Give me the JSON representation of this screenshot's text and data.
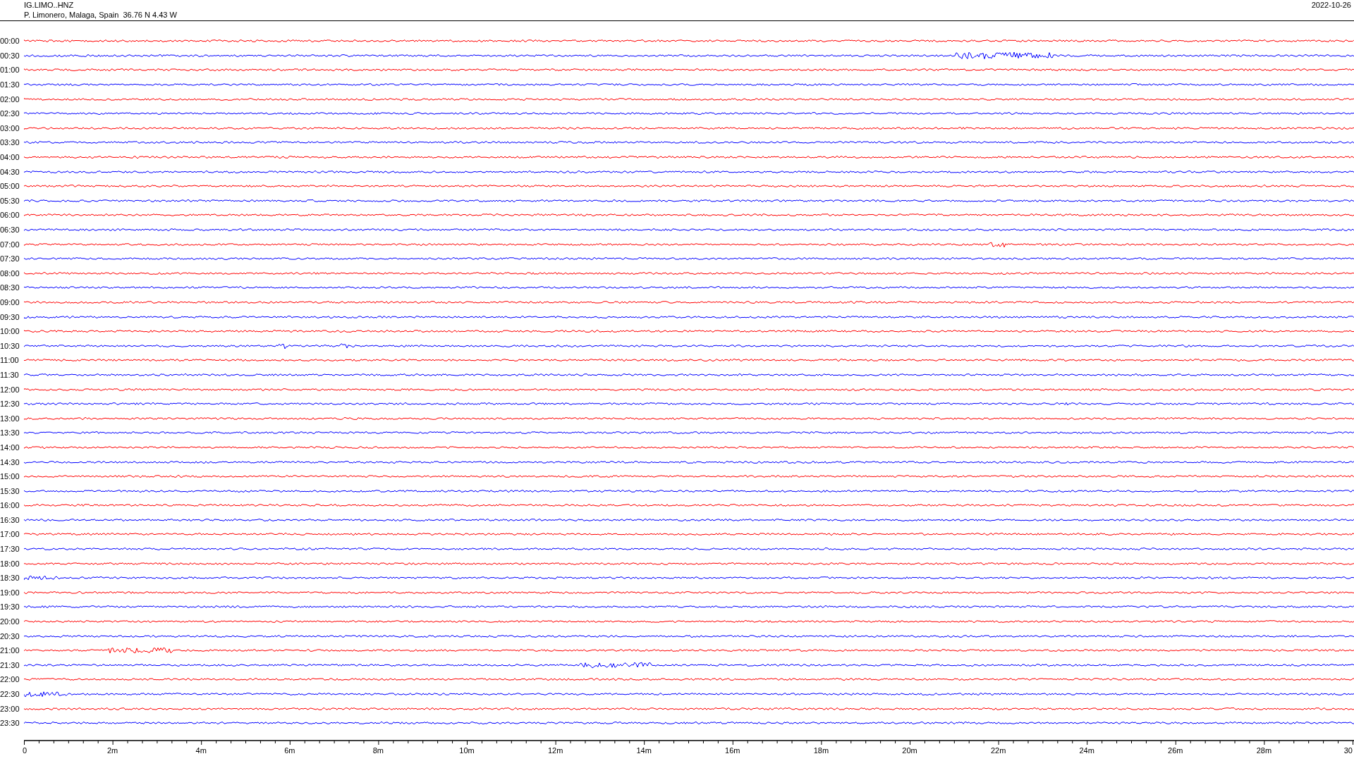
{
  "header": {
    "station": "IG.LIMO..HNZ",
    "location": "P. Limonero, Malaga, Spain  36.76 N 4.43 W",
    "date": "2022-10-26"
  },
  "rows": [
    {
      "label": "00:00",
      "color": "#ff0000"
    },
    {
      "label": "00:30",
      "color": "#0000ff"
    },
    {
      "label": "01:00",
      "color": "#ff0000"
    },
    {
      "label": "01:30",
      "color": "#0000ff"
    },
    {
      "label": "02:00",
      "color": "#ff0000"
    },
    {
      "label": "02:30",
      "color": "#0000ff"
    },
    {
      "label": "03:00",
      "color": "#ff0000"
    },
    {
      "label": "03:30",
      "color": "#0000ff"
    },
    {
      "label": "04:00",
      "color": "#ff0000"
    },
    {
      "label": "04:30",
      "color": "#0000ff"
    },
    {
      "label": "05:00",
      "color": "#ff0000"
    },
    {
      "label": "05:30",
      "color": "#0000ff"
    },
    {
      "label": "06:00",
      "color": "#ff0000"
    },
    {
      "label": "06:30",
      "color": "#0000ff"
    },
    {
      "label": "07:00",
      "color": "#ff0000"
    },
    {
      "label": "07:30",
      "color": "#0000ff"
    },
    {
      "label": "08:00",
      "color": "#ff0000"
    },
    {
      "label": "08:30",
      "color": "#0000ff"
    },
    {
      "label": "09:00",
      "color": "#ff0000"
    },
    {
      "label": "09:30",
      "color": "#0000ff"
    },
    {
      "label": "10:00",
      "color": "#ff0000"
    },
    {
      "label": "10:30",
      "color": "#0000ff"
    },
    {
      "label": "11:00",
      "color": "#ff0000"
    },
    {
      "label": "11:30",
      "color": "#0000ff"
    },
    {
      "label": "12:00",
      "color": "#ff0000"
    },
    {
      "label": "12:30",
      "color": "#0000ff"
    },
    {
      "label": "13:00",
      "color": "#ff0000"
    },
    {
      "label": "13:30",
      "color": "#0000ff"
    },
    {
      "label": "14:00",
      "color": "#ff0000"
    },
    {
      "label": "14:30",
      "color": "#0000ff"
    },
    {
      "label": "15:00",
      "color": "#ff0000"
    },
    {
      "label": "15:30",
      "color": "#0000ff"
    },
    {
      "label": "16:00",
      "color": "#ff0000"
    },
    {
      "label": "16:30",
      "color": "#0000ff"
    },
    {
      "label": "17:00",
      "color": "#ff0000"
    },
    {
      "label": "17:30",
      "color": "#0000ff"
    },
    {
      "label": "18:00",
      "color": "#ff0000"
    },
    {
      "label": "18:30",
      "color": "#0000ff"
    },
    {
      "label": "19:00",
      "color": "#ff0000"
    },
    {
      "label": "19:30",
      "color": "#0000ff"
    },
    {
      "label": "20:00",
      "color": "#ff0000"
    },
    {
      "label": "20:30",
      "color": "#0000ff"
    },
    {
      "label": "21:00",
      "color": "#ff0000"
    },
    {
      "label": "21:30",
      "color": "#0000ff"
    },
    {
      "label": "22:00",
      "color": "#ff0000"
    },
    {
      "label": "22:30",
      "color": "#0000ff"
    },
    {
      "label": "23:00",
      "color": "#ff0000"
    },
    {
      "label": "23:30",
      "color": "#0000ff"
    }
  ],
  "x_axis": {
    "labels": [
      "0",
      "2m",
      "4m",
      "6m",
      "8m",
      "10m",
      "12m",
      "14m",
      "16m",
      "18m",
      "20m",
      "22m",
      "24m",
      "26m",
      "28m",
      "30"
    ]
  }
}
